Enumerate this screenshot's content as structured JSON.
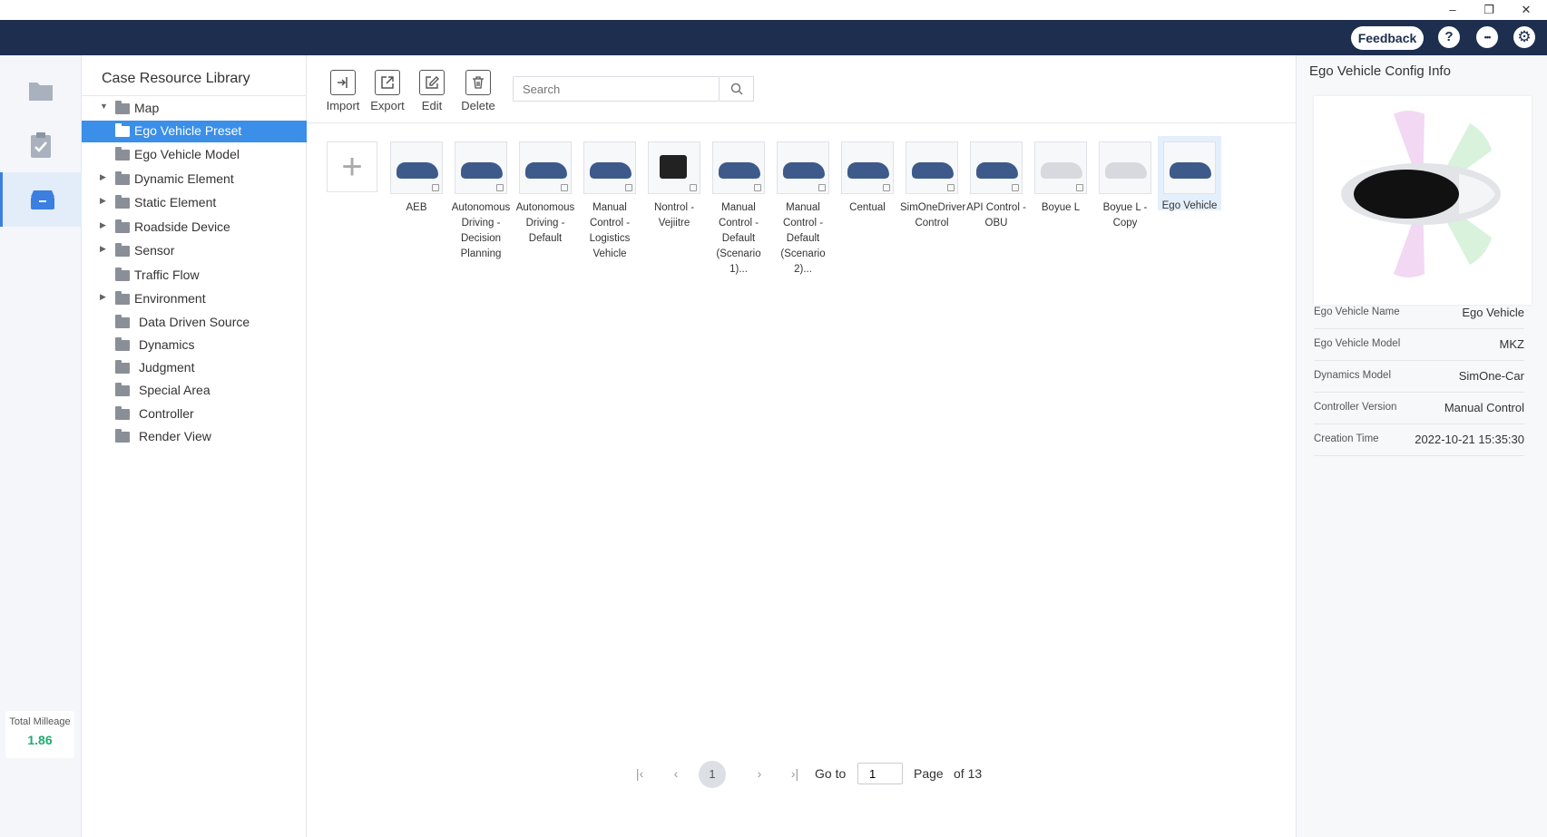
{
  "colors": {
    "header_bg": "#1d2e4f",
    "accent": "#3b8fe8",
    "mileage": "#1faa70"
  },
  "window_controls": {
    "minimize": "–",
    "restore": "❐",
    "close": "✕"
  },
  "header": {
    "feedback_label": "Feedback",
    "help_icon": "?",
    "more_icon": "•••",
    "settings_icon": "⚙"
  },
  "rail": {
    "mileage_label": "Total Milleage",
    "mileage_value": "1.86",
    "expand_icon": "›"
  },
  "tree": {
    "title": "Case Resource Library",
    "items": [
      {
        "label": "Map",
        "arrow": "▼"
      },
      {
        "label": "Ego Vehicle Preset",
        "arrow": ""
      },
      {
        "label": "Ego Vehicle Model",
        "arrow": ""
      },
      {
        "label": "Dynamic Element",
        "arrow": "▶"
      },
      {
        "label": "Static Element",
        "arrow": "▶"
      },
      {
        "label": "Roadside Device",
        "arrow": "▶"
      },
      {
        "label": "Sensor",
        "arrow": "▶"
      },
      {
        "label": "Traffic Flow",
        "arrow": ""
      },
      {
        "label": "Environment",
        "arrow": "▶"
      },
      {
        "label": "Data Driven Source",
        "arrow": ""
      },
      {
        "label": "Dynamics",
        "arrow": ""
      },
      {
        "label": "Judgment",
        "arrow": ""
      },
      {
        "label": "Special Area",
        "arrow": ""
      },
      {
        "label": "Controller",
        "arrow": ""
      },
      {
        "label": "Render View",
        "arrow": ""
      }
    ]
  },
  "toolbar": {
    "import_label": "Import",
    "export_label": "Export",
    "edit_label": "Edit",
    "delete_label": "Delete",
    "search_placeholder": "Search"
  },
  "add_icon": "+",
  "vehicles": [
    {
      "label": "AEB"
    },
    {
      "label": "Autonomous Driving - Decision Planning"
    },
    {
      "label": "Autonomous Driving - Default"
    },
    {
      "label": "Manual Control - Logistics Vehicle"
    },
    {
      "label": "Nontrol - Vejiitre"
    },
    {
      "label": "Manual Control - Default (Scenario 1)..."
    },
    {
      "label": "Manual Control - Default (Scenario 2)..."
    },
    {
      "label": "Centual"
    },
    {
      "label": "SimOneDriver Control"
    },
    {
      "label": "API Control - OBU"
    },
    {
      "label": "Boyue L"
    },
    {
      "label": "Boyue L - Copy"
    },
    {
      "label": "Ego Vehicle"
    }
  ],
  "pager": {
    "first": "|‹",
    "prev": "‹",
    "current": "1",
    "next": "›",
    "last": "›|",
    "goto_label": "Go to",
    "goto_value": "1",
    "page_label": "Page",
    "of_label": "of 13"
  },
  "config": {
    "title": "Ego Vehicle Config Info",
    "rows": [
      {
        "key": "Ego Vehicle Name",
        "value": "Ego Vehicle"
      },
      {
        "key": "Ego Vehicle Model",
        "value": "MKZ"
      },
      {
        "key": "Dynamics Model",
        "value": "SimOne-Car"
      },
      {
        "key": "Controller Version",
        "value": "Manual Control"
      },
      {
        "key": "Creation Time",
        "value": "2022-10-21 15:35:30"
      }
    ]
  }
}
